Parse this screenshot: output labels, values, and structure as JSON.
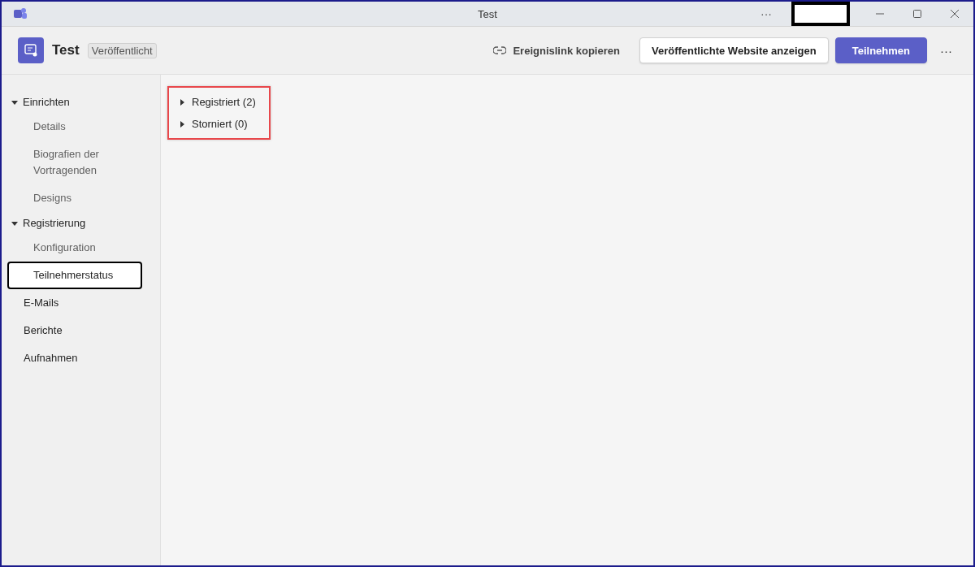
{
  "window": {
    "title": "Test",
    "more": "···"
  },
  "header": {
    "title": "Test",
    "badge": "Veröffentlicht",
    "copy_link": "Ereignislink kopieren",
    "view_site": "Veröffentlichte Website anzeigen",
    "join": "Teilnehmen",
    "more": "···"
  },
  "sidebar": {
    "items": [
      {
        "label": "Einrichten",
        "expanded": true,
        "children": [
          {
            "label": "Details",
            "selected": false
          },
          {
            "label": "Biografien der Vortragenden",
            "selected": false
          },
          {
            "label": "Designs",
            "selected": false
          }
        ]
      },
      {
        "label": "Registrierung",
        "expanded": true,
        "children": [
          {
            "label": "Konfiguration",
            "selected": false
          },
          {
            "label": "Teilnehmerstatus",
            "selected": true
          }
        ]
      },
      {
        "label": "E-Mails",
        "selected": false
      },
      {
        "label": "Berichte",
        "selected": false
      },
      {
        "label": "Aufnahmen",
        "selected": false
      }
    ]
  },
  "content": {
    "sections": [
      {
        "label": "Registriert (2)",
        "expanded": false
      },
      {
        "label": "Storniert (0)",
        "expanded": false
      }
    ]
  }
}
